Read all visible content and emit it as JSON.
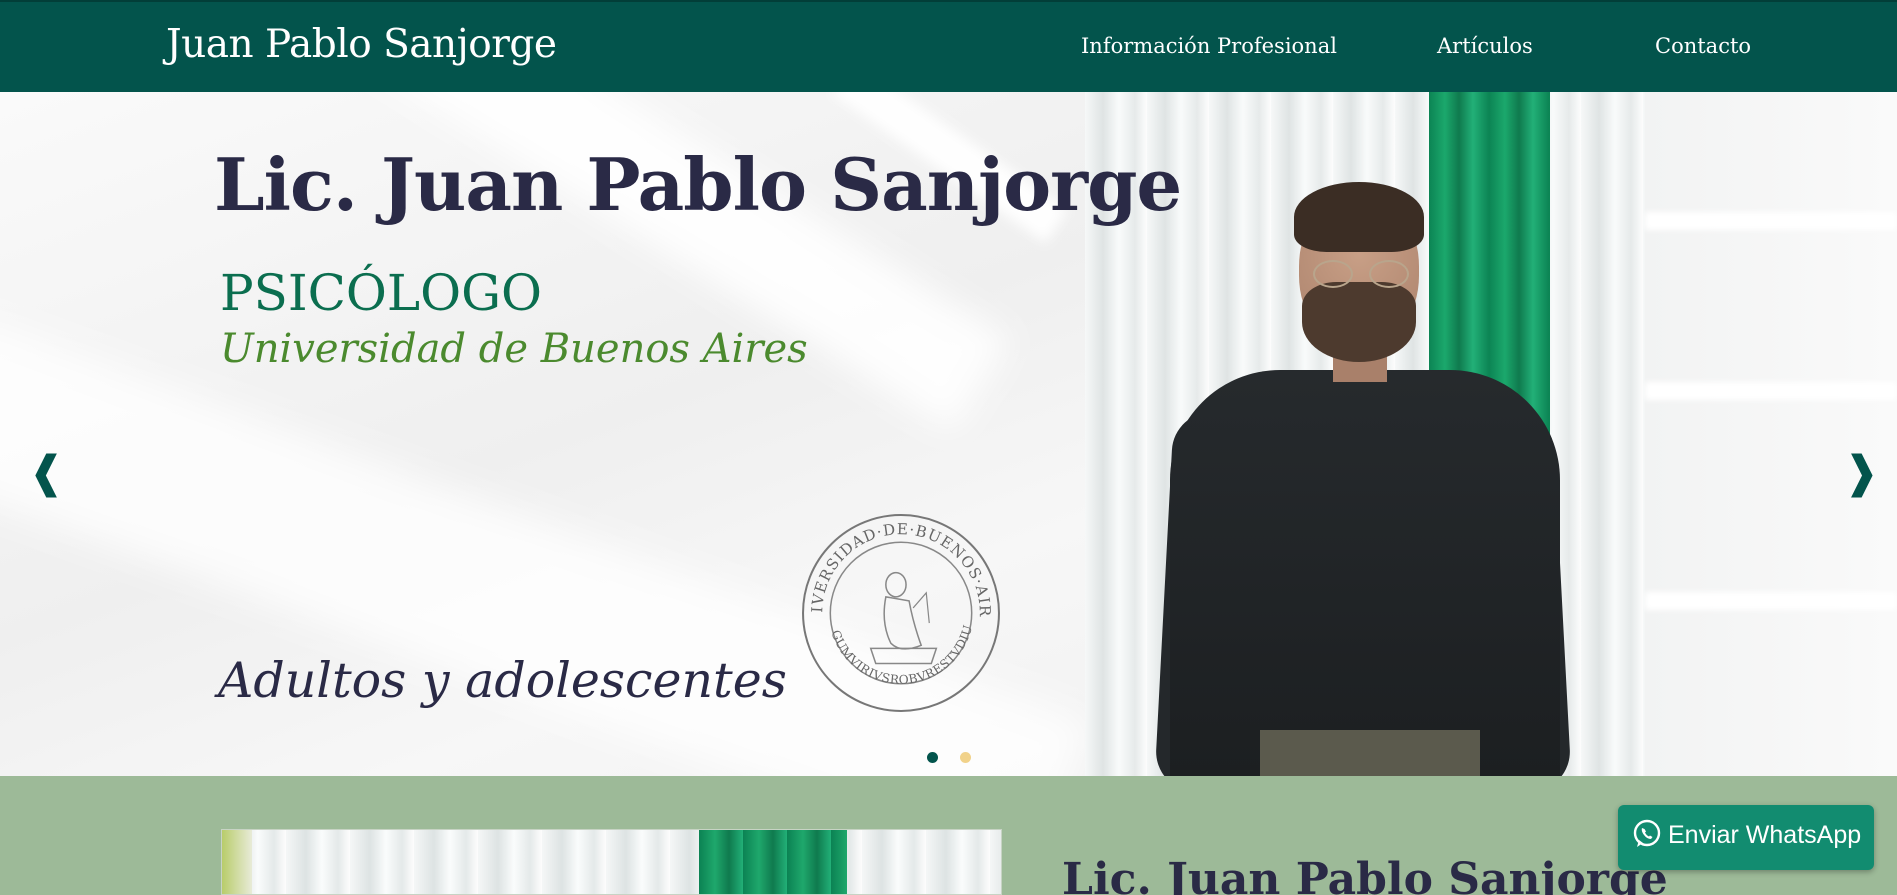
{
  "navbar": {
    "brand": "Juan Pablo Sanjorge",
    "links": [
      "Información Profesional",
      "Artículos",
      "Contacto"
    ]
  },
  "hero": {
    "title": "Lic. Juan Pablo Sanjorge",
    "profession": "PSICÓLOGO",
    "university": "Universidad de Buenos Aires",
    "audience": "Adultos y adolescentes",
    "seal_text": "UNIVERSIDAD·DE·BUENOS·AIRES",
    "seal_motto": "ARGUMVIRIVSROBVRESTVDIUM",
    "prev_icon": "chevron-left-icon",
    "next_icon": "chevron-right-icon",
    "slides": 2,
    "active_slide": 1
  },
  "about": {
    "title": "Lic. Juan Pablo Sanjorge"
  },
  "whatsapp": {
    "label": "Enviar WhatsApp",
    "icon": "whatsapp-icon"
  },
  "colors": {
    "primary": "#03544c",
    "accent_green": "#0b6e4f",
    "university_green": "#4b8a2e",
    "title_navy": "#2a2a46",
    "section_bg": "#9dba98",
    "whatsapp": "#128c70",
    "dot_inactive": "#f1d28a"
  }
}
